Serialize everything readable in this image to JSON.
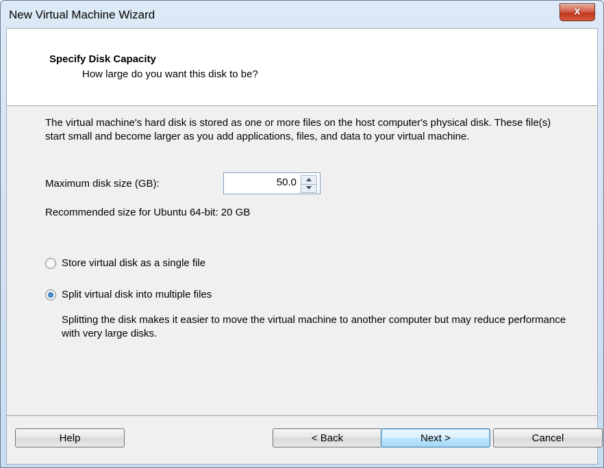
{
  "window": {
    "title": "New Virtual Machine Wizard",
    "close_label": "x"
  },
  "header": {
    "title": "Specify Disk Capacity",
    "subtitle": "How large do you want this disk to be?"
  },
  "body": {
    "description": "The virtual machine's hard disk is stored as one or more files on the host computer's physical disk. These file(s) start small and become larger as you add applications, files, and data to your virtual machine.",
    "size_label": "Maximum disk size (GB):",
    "size_value": "50.0",
    "recommended": "Recommended size for Ubuntu 64-bit: 20 GB",
    "radio_single": "Store virtual disk as a single file",
    "radio_split": "Split virtual disk into multiple files",
    "selected_option": "split",
    "split_description": "Splitting the disk makes it easier to move the virtual machine to another computer but may reduce performance with very large disks."
  },
  "buttons": {
    "help": "Help",
    "back": "< Back",
    "next": "Next >",
    "cancel": "Cancel"
  }
}
